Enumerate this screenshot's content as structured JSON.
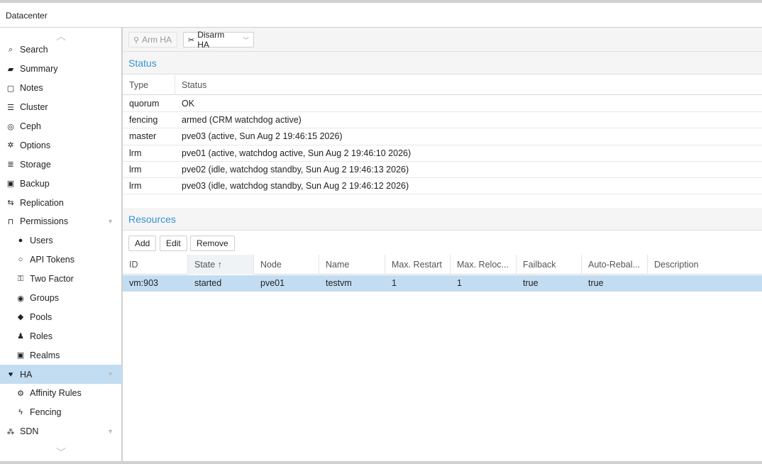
{
  "title": "Datacenter",
  "sidebar": {
    "items": [
      {
        "label": "Search",
        "icon": "search-icon",
        "glyph": "⌕",
        "level": 0
      },
      {
        "label": "Summary",
        "icon": "book-icon",
        "glyph": "▰",
        "level": 0
      },
      {
        "label": "Notes",
        "icon": "note-icon",
        "glyph": "▢",
        "level": 0
      },
      {
        "label": "Cluster",
        "icon": "server-icon",
        "glyph": "☰",
        "level": 0
      },
      {
        "label": "Ceph",
        "icon": "ceph-icon",
        "glyph": "◎",
        "level": 0
      },
      {
        "label": "Options",
        "icon": "gear-icon",
        "glyph": "✲",
        "level": 0
      },
      {
        "label": "Storage",
        "icon": "database-icon",
        "glyph": "≣",
        "level": 0
      },
      {
        "label": "Backup",
        "icon": "floppy-icon",
        "glyph": "▣",
        "level": 0
      },
      {
        "label": "Replication",
        "icon": "retweet-icon",
        "glyph": "⇆",
        "level": 0
      },
      {
        "label": "Permissions",
        "icon": "unlock-icon",
        "glyph": "⊓",
        "level": 0,
        "expandable": true
      },
      {
        "label": "Users",
        "icon": "user-icon",
        "glyph": "●",
        "level": 1
      },
      {
        "label": "API Tokens",
        "icon": "user-outline-icon",
        "glyph": "○",
        "level": 1
      },
      {
        "label": "Two Factor",
        "icon": "key-icon",
        "glyph": "⚿",
        "level": 1
      },
      {
        "label": "Groups",
        "icon": "users-icon",
        "glyph": "◉",
        "level": 1
      },
      {
        "label": "Pools",
        "icon": "tags-icon",
        "glyph": "◆",
        "level": 1
      },
      {
        "label": "Roles",
        "icon": "male-icon",
        "glyph": "♟",
        "level": 1
      },
      {
        "label": "Realms",
        "icon": "id-card-icon",
        "glyph": "▣",
        "level": 1
      },
      {
        "label": "HA",
        "icon": "heartbeat-icon",
        "glyph": "♥",
        "level": 0,
        "selected": true,
        "expandable": true
      },
      {
        "label": "Affinity Rules",
        "icon": "cogs-icon",
        "glyph": "⚙",
        "level": 1
      },
      {
        "label": "Fencing",
        "icon": "bolt-icon",
        "glyph": "ϟ",
        "level": 1
      },
      {
        "label": "SDN",
        "icon": "sdn-icon",
        "glyph": "⁂",
        "level": 0,
        "expandable": true
      }
    ]
  },
  "toolbar": {
    "arm_label": "Arm HA",
    "disarm_label": "Disarm HA"
  },
  "status": {
    "title": "Status",
    "columns": [
      "Type",
      "Status"
    ],
    "rows": [
      {
        "type": "quorum",
        "status": "OK"
      },
      {
        "type": "fencing",
        "status": "armed (CRM watchdog active)"
      },
      {
        "type": "master",
        "status": "pve03 (active, Sun Aug 2 19:46:15 2026)"
      },
      {
        "type": "lrm",
        "status": "pve01 (active, watchdog active, Sun Aug 2 19:46:10 2026)"
      },
      {
        "type": "lrm",
        "status": "pve02 (idle, watchdog standby, Sun Aug 2 19:46:13 2026)"
      },
      {
        "type": "lrm",
        "status": "pve03 (idle, watchdog standby, Sun Aug 2 19:46:12 2026)"
      }
    ]
  },
  "resources": {
    "title": "Resources",
    "buttons": {
      "add": "Add",
      "edit": "Edit",
      "remove": "Remove"
    },
    "columns": [
      "ID",
      "State ↑",
      "Node",
      "Name",
      "Max. Restart",
      "Max. Reloc...",
      "Failback",
      "Auto-Rebal...",
      "Description"
    ],
    "rows": [
      {
        "id": "vm:903",
        "state": "started",
        "node": "pve01",
        "name": "testvm",
        "max_restart": "1",
        "max_relocate": "1",
        "failback": "true",
        "auto_rebalance": "true",
        "description": ""
      }
    ]
  }
}
